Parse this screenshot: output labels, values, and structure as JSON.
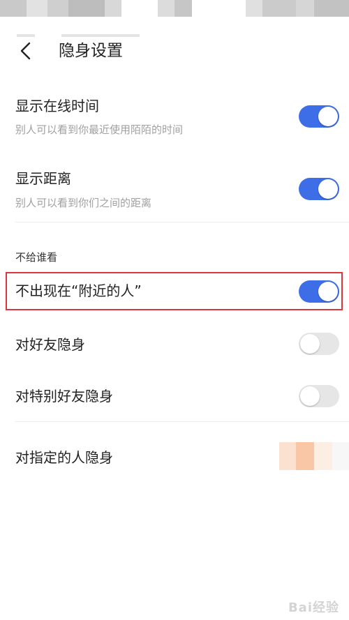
{
  "header": {
    "title": "隐身设置",
    "back_icon": "chevron-left-icon"
  },
  "settings": {
    "show_online_time": {
      "label": "显示在线时间",
      "description": "别人可以看到你最近使用陌陌的时间",
      "enabled": true
    },
    "show_distance": {
      "label": "显示距离",
      "description": "别人可以看到你们之间的距离",
      "enabled": true
    }
  },
  "hide_from": {
    "section_title": "不给谁看",
    "nearby": {
      "label": "不出现在“附近的人”",
      "enabled": true
    },
    "friends": {
      "label": "对好友隐身",
      "enabled": false
    },
    "special_friends": {
      "label": "对特别好友隐身",
      "enabled": false
    },
    "specified_people": {
      "label": "对指定的人隐身"
    }
  },
  "colors": {
    "toggle_on": "#3d6ee8",
    "toggle_off": "#e6e6e6",
    "highlight_border": "#d9363e"
  }
}
